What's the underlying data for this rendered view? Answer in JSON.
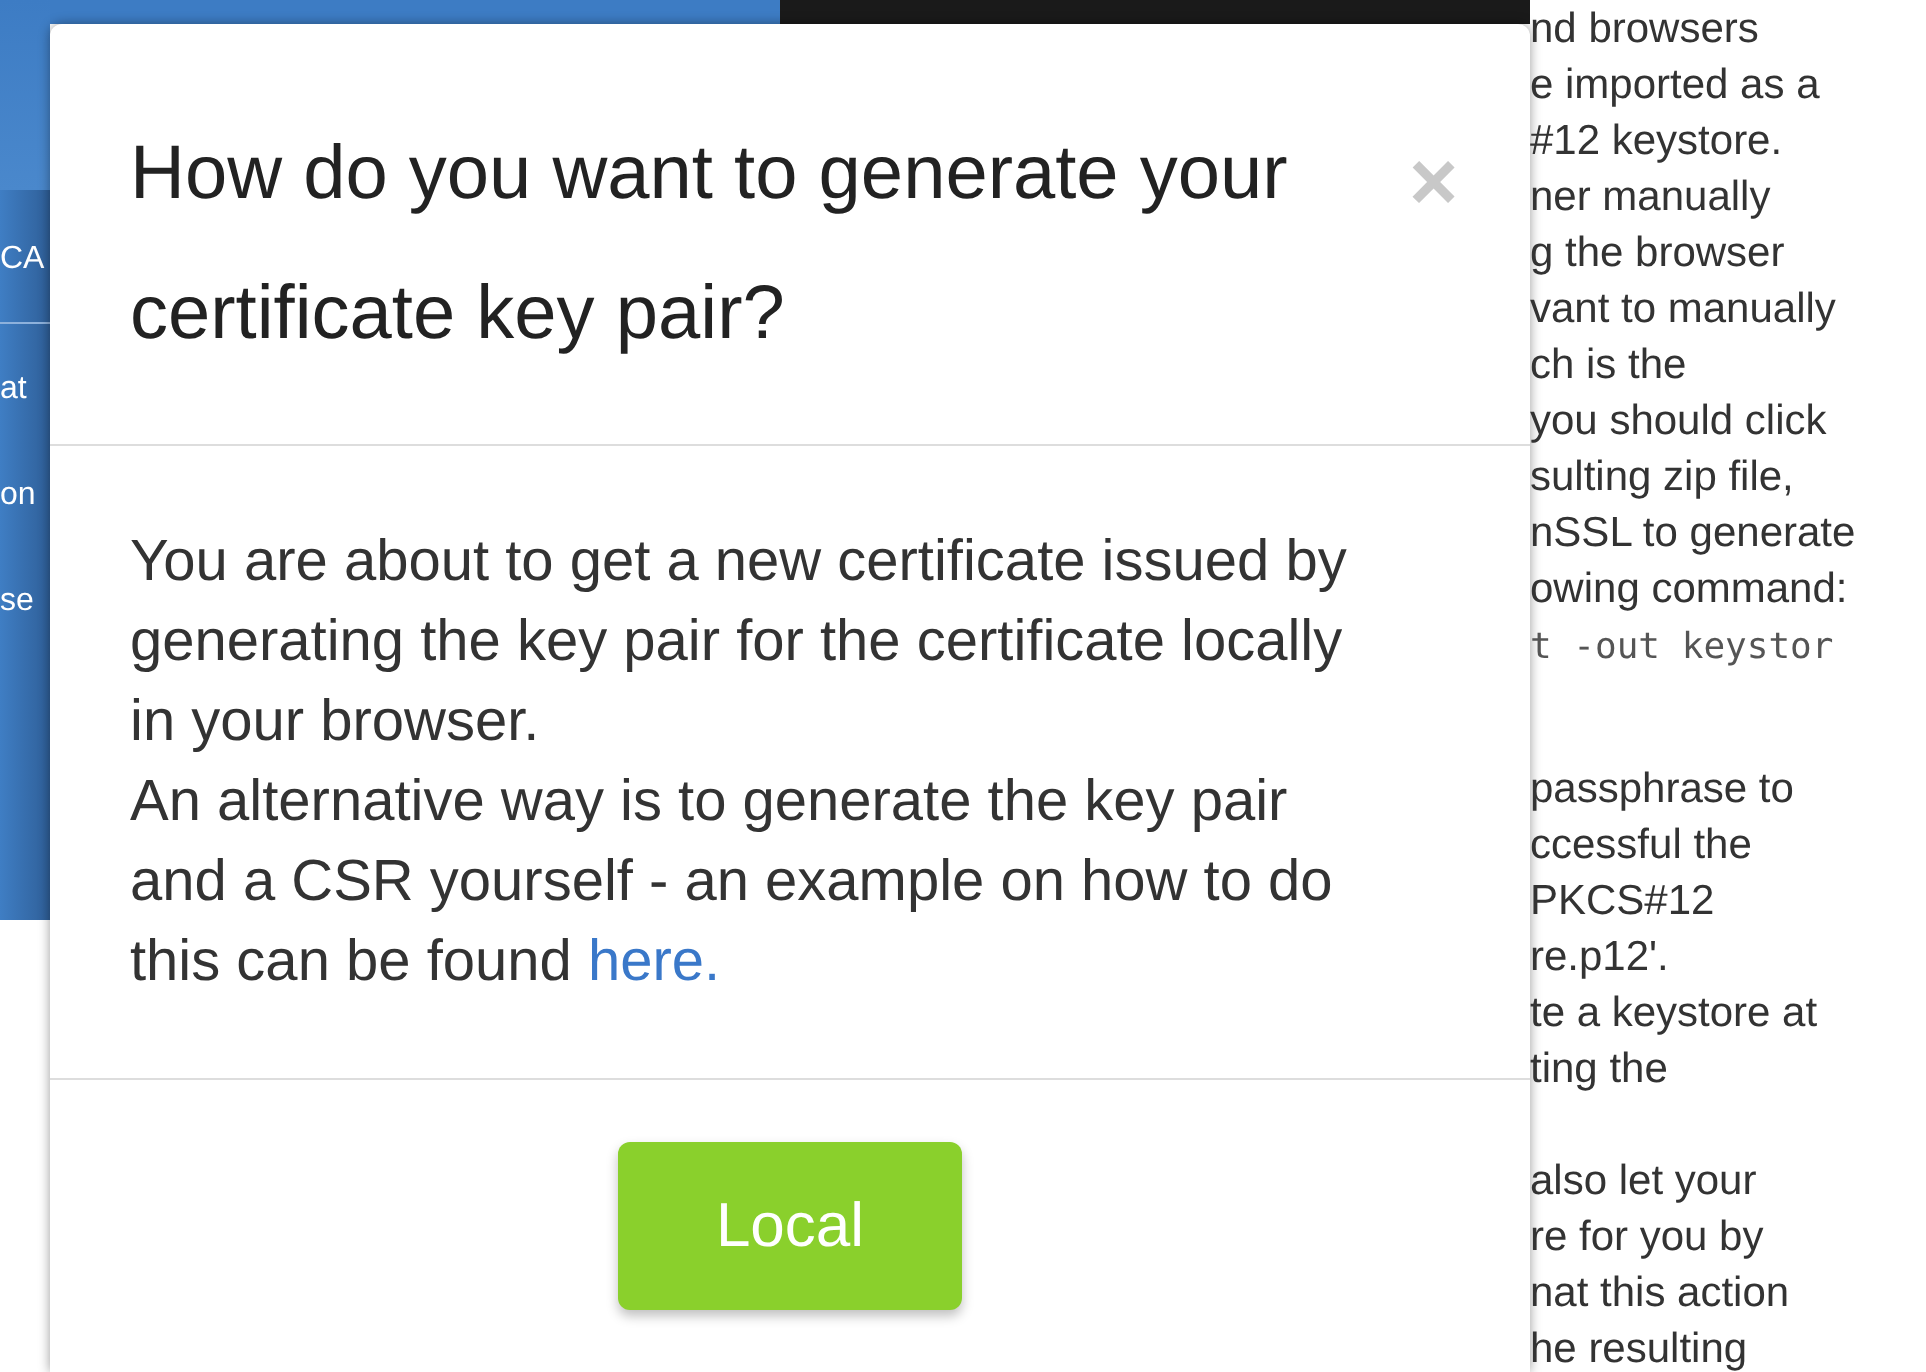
{
  "sidebar": {
    "items": [
      {
        "label": "CA"
      },
      {
        "label": "at"
      },
      {
        "label": "on"
      },
      {
        "label": "se"
      }
    ]
  },
  "dialog": {
    "title": "How do you want to generate your certificate key pair?",
    "close": "×",
    "paragraphs": [
      {
        "text": "You are about to get a new certificate issued by generating the key pair for the certificate locally in your browser."
      },
      {
        "text": "An alternative way is to generate the key pair and a CSR yourself - an example on how to do this can be found",
        "link": "here."
      }
    ],
    "button": "Local"
  },
  "background_text": [
    {
      "kind": "text",
      "lines": [
        "nd browsers",
        "e imported as a",
        "#12 keystore.",
        "ner manually",
        "g the browser",
        "vant to manually",
        "ch is the",
        "you should click",
        "sulting zip file,",
        "nSSL to generate",
        "owing command:"
      ]
    },
    {
      "kind": "code",
      "lines": [
        "t -out keystor"
      ]
    },
    {
      "kind": "text",
      "lines": [
        "passphrase to",
        "ccessful the",
        "PKCS#12",
        "re.p12'.",
        "te a keystore at",
        "ting the"
      ]
    },
    {
      "kind": "text",
      "lines": [
        "also let your",
        "re for you by",
        "nat this action",
        "he resulting"
      ]
    }
  ]
}
